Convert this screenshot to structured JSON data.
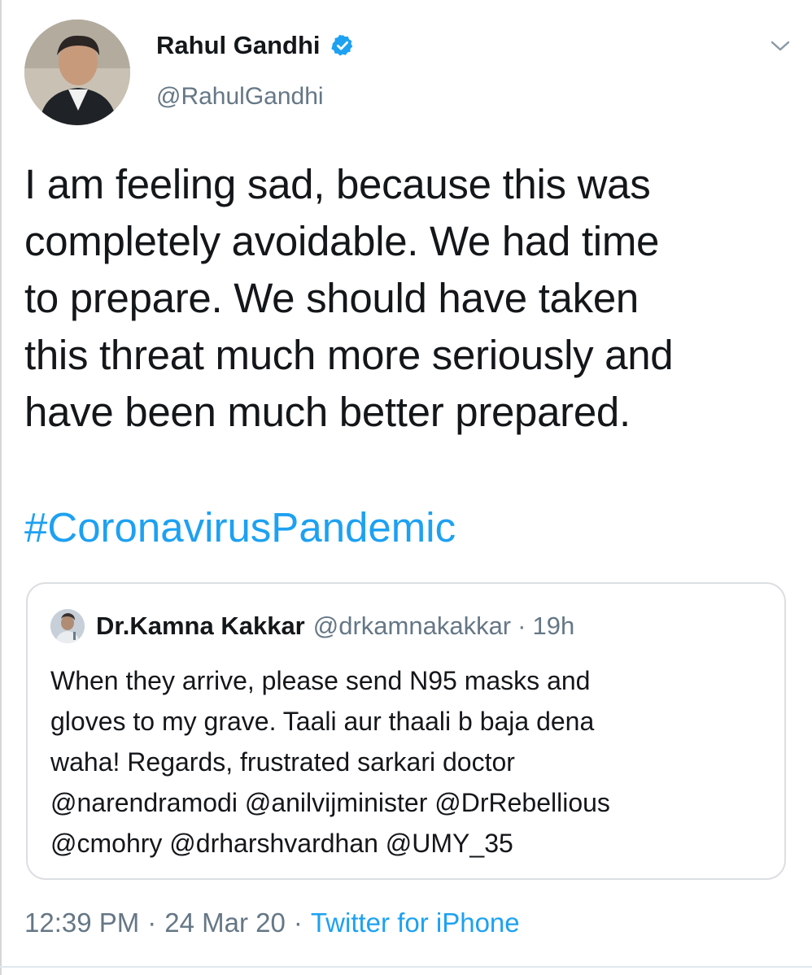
{
  "tweet": {
    "display_name": "Rahul Gandhi",
    "handle": "@RahulGandhi",
    "verified_icon": "verified-badge-icon",
    "menu_icon": "chevron-down-icon",
    "text": "I am feeling sad, because this was\ncompletely avoidable. We had time\nto prepare. We should have taken\nthis threat much more seriously and\nhave been much better prepared.",
    "hashtag": "#CoronavirusPandemic",
    "time": "12:39 PM",
    "date": "24 Mar 20",
    "separator": "·",
    "source": "Twitter for iPhone"
  },
  "quote": {
    "display_name": "Dr.Kamna Kakkar",
    "handle": "@drkamnakakkar",
    "separator": "·",
    "time": "19h",
    "text": "When they arrive, please send N95 masks and\ngloves to my grave. Taali aur thaali b baja dena\nwaha! Regards, frustrated sarkari doctor\n@narendramodi @anilvijminister @DrRebellious\n@cmohry @drharshvardhan @UMY_35"
  },
  "colors": {
    "link": "#1da1f2",
    "secondary_text": "#657786",
    "primary_text": "#14171a",
    "border": "#dcdfe2"
  }
}
